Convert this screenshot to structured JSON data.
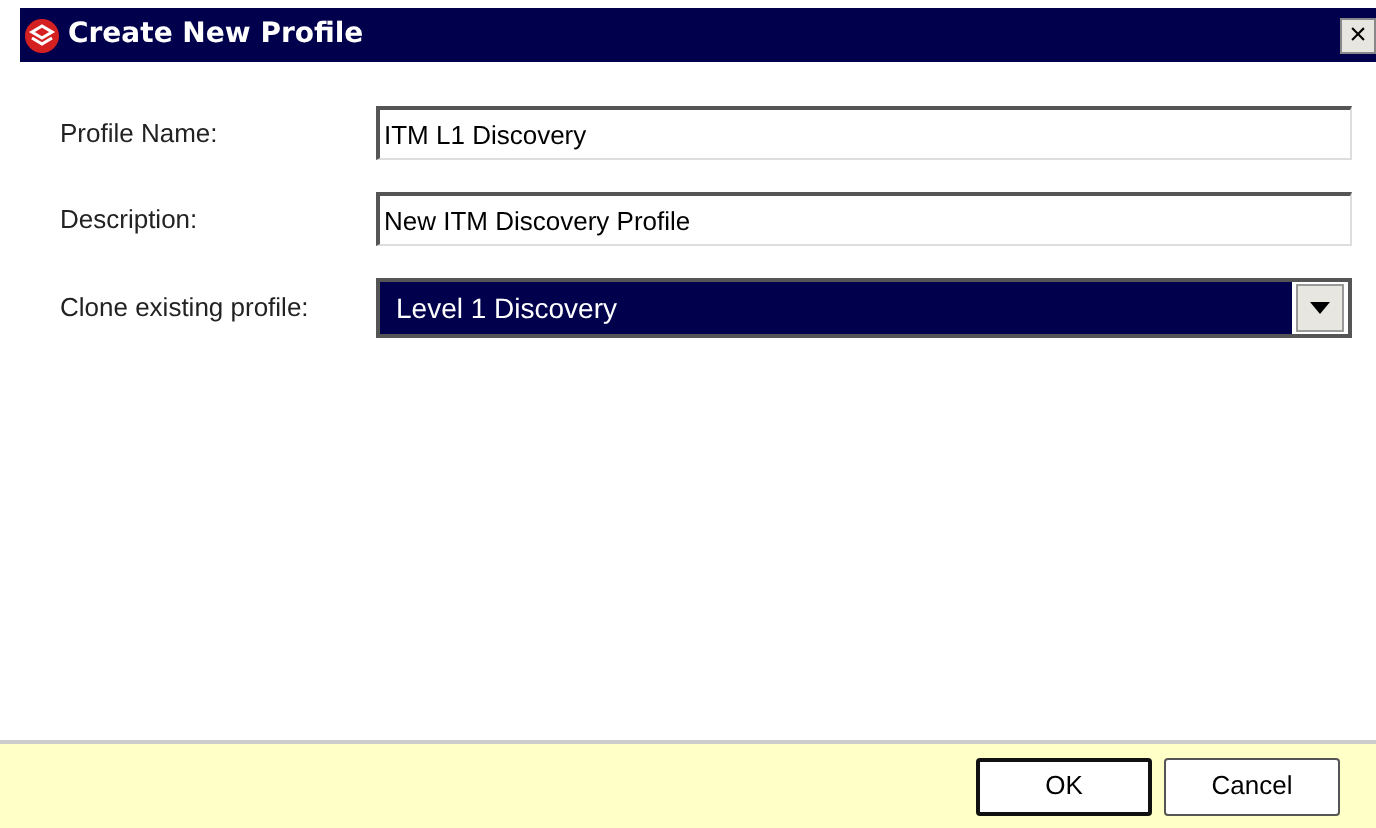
{
  "window": {
    "title": "Create New Profile",
    "close": "×"
  },
  "fields": [
    {
      "label": "Profile Name:",
      "kind": "text",
      "value": "ITM L1 Discovery"
    },
    {
      "label": "Description:",
      "kind": "text",
      "value": "New ITM Discovery Profile"
    },
    {
      "label": "Clone existing profile:",
      "kind": "dropdown",
      "value": "Level 1 Discovery",
      "focused": true
    }
  ],
  "buttons": [
    {
      "label": "OK",
      "default": true
    },
    {
      "label": "Cancel",
      "default": false
    }
  ]
}
